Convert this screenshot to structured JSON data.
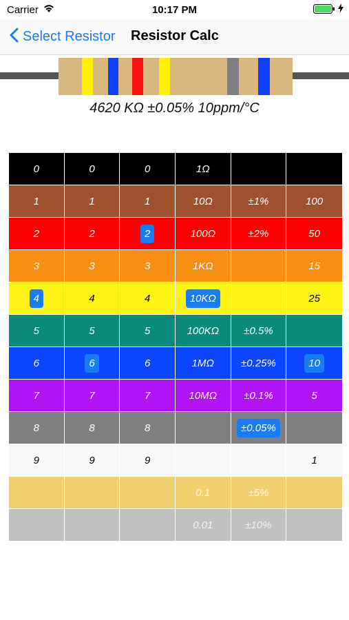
{
  "status_bar": {
    "carrier": "Carrier",
    "time": "10:17 PM"
  },
  "nav": {
    "back_label": "Select Resistor",
    "title": "Resistor Calc"
  },
  "resistor": {
    "body_color": "#d9b77d",
    "bands": [
      {
        "color": "#ffef00",
        "name": "yellow"
      },
      {
        "color": "#1040ff",
        "name": "blue"
      },
      {
        "color": "#ff1010",
        "name": "red"
      },
      {
        "color": "#ffef00",
        "name": "yellow"
      },
      {
        "color": "#808080",
        "name": "gray"
      },
      {
        "color": "#1040ff",
        "name": "blue"
      }
    ],
    "value_text": "4620 KΩ ±0.05% 10ppm/°C"
  },
  "grid": {
    "rows": [
      {
        "name": "black",
        "bg": "#000000",
        "fg": "#ffffff",
        "cells": [
          "0",
          "0",
          "0",
          "1Ω",
          "",
          ""
        ]
      },
      {
        "name": "brown",
        "bg": "#a0522d",
        "fg": "#ffffff",
        "cells": [
          "1",
          "1",
          "1",
          "10Ω",
          "±1%",
          "100"
        ]
      },
      {
        "name": "red",
        "bg": "#ff0000",
        "fg": "#ffffff",
        "cells": [
          "2",
          "2",
          "2",
          "100Ω",
          "±2%",
          "50"
        ]
      },
      {
        "name": "orange",
        "bg": "#f98e10",
        "fg": "#ffffff",
        "cells": [
          "3",
          "3",
          "3",
          "1KΩ",
          "",
          "15"
        ]
      },
      {
        "name": "yellow",
        "bg": "#fff314",
        "fg": "#000000",
        "cells": [
          "4",
          "4",
          "4",
          "10KΩ",
          "",
          "25"
        ]
      },
      {
        "name": "green",
        "bg": "#0b8a7b",
        "fg": "#ffffff",
        "cells": [
          "5",
          "5",
          "5",
          "100KΩ",
          "±0.5%",
          ""
        ]
      },
      {
        "name": "blue",
        "bg": "#0c45ff",
        "fg": "#ffffff",
        "cells": [
          "6",
          "6",
          "6",
          "1MΩ",
          "±0.25%",
          "10"
        ]
      },
      {
        "name": "violet",
        "bg": "#b213f5",
        "fg": "#ffffff",
        "cells": [
          "7",
          "7",
          "7",
          "10MΩ",
          "±0.1%",
          "5"
        ]
      },
      {
        "name": "gray",
        "bg": "#808080",
        "fg": "#ffffff",
        "cells": [
          "8",
          "8",
          "8",
          "",
          "±0.05%",
          ""
        ]
      },
      {
        "name": "white",
        "bg": "#f7f7f7",
        "fg": "#000000",
        "cells": [
          "9",
          "9",
          "9",
          "",
          "",
          "1"
        ]
      },
      {
        "name": "gold",
        "bg": "#f1cf6e",
        "fg": "#fff6dc",
        "cells": [
          "",
          "",
          "",
          "0.1",
          "±5%",
          ""
        ]
      },
      {
        "name": "silver",
        "bg": "#c0c0c0",
        "fg": "#f2f2f2",
        "cells": [
          "",
          "",
          "",
          "0.01",
          "±10%",
          ""
        ]
      }
    ],
    "columns": [
      "band-1",
      "band-2",
      "band-3",
      "multiplier",
      "tolerance",
      "tempco"
    ],
    "selected": [
      [
        4,
        0
      ],
      [
        6,
        1
      ],
      [
        2,
        2
      ],
      [
        4,
        3
      ],
      [
        8,
        4
      ],
      [
        6,
        5
      ]
    ]
  }
}
